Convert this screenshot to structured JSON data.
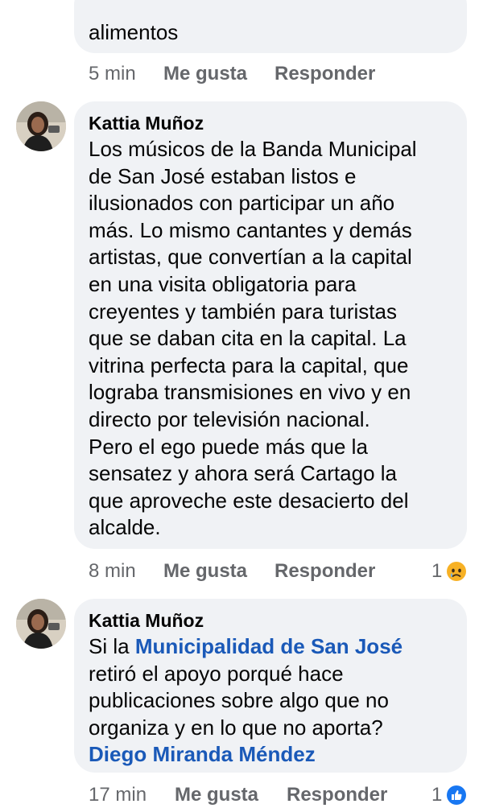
{
  "comments": [
    {
      "text_tail": "alimentos",
      "time": "5 min",
      "like_label": "Me gusta",
      "reply_label": "Responder"
    },
    {
      "author": "Kattia Muñoz",
      "text_lines": [
        "Los músicos de la Banda Municipal",
        "de San José estaban listos e",
        "ilusionados con participar un año",
        "más. Lo mismo cantantes y demás",
        "artistas, que convertían a la capital",
        "en una visita obligatoria para",
        "creyentes y también para turistas",
        "que se daban cita en la capital. La",
        "vitrina perfecta para la capital, que",
        "lograba transmisiones en vivo y en",
        "directo por televisión nacional.",
        "Pero el ego puede más que la",
        "sensatez y ahora será Cartago la",
        "que aproveche este desacierto del",
        "alcalde."
      ],
      "time": "8 min",
      "like_label": "Me gusta",
      "reply_label": "Responder",
      "reaction_count": "1",
      "reaction_icon": "sad-face-icon",
      "reaction_color": "#f7b125"
    },
    {
      "author": "Kattia Muñoz",
      "line1_prefix": "Si la ",
      "line1_tag": "Municipalidad de San José",
      "line2": "retiró el apoyo porqué hace",
      "line3": "publicaciones sobre algo que no",
      "line4": "organiza y en lo que no aporta?",
      "line5_tag": "Diego Miranda Méndez",
      "time": "17 min",
      "like_label": "Me gusta",
      "reply_label": "Responder",
      "reaction_count": "1",
      "reaction_icon": "like-thumb-icon",
      "reaction_color": "#1877f2"
    }
  ],
  "colors": {
    "bubble": "#f0f2f5",
    "meta_text": "#65676b",
    "mention": "#1a59b8"
  }
}
